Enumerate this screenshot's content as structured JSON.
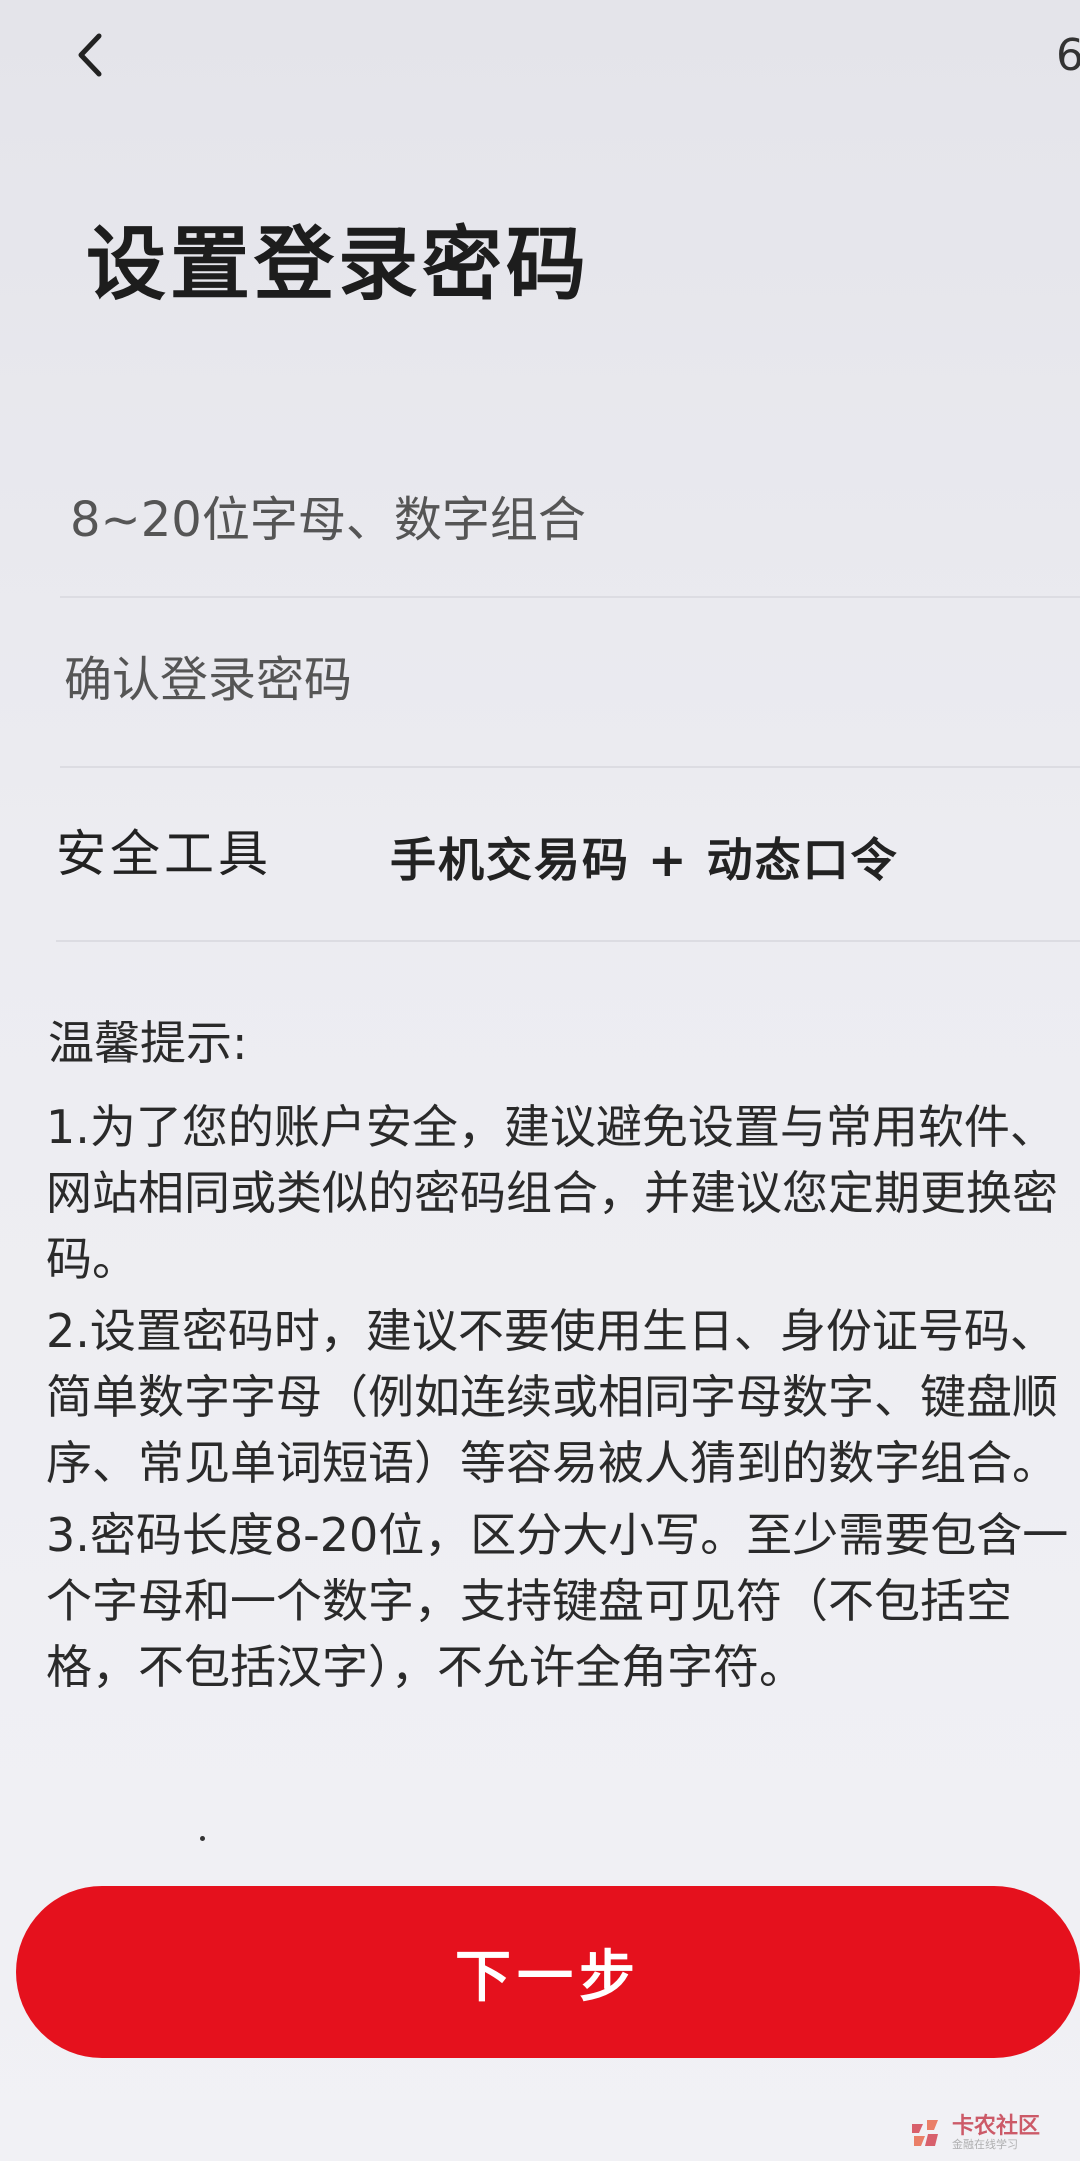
{
  "header": {
    "back_icon": "chevron-left-icon",
    "corner_glyph": "6",
    "title": "设置登录密码"
  },
  "form": {
    "password_placeholder": "8~20位字母、数字组合",
    "confirm_placeholder": "确认登录密码",
    "security_label": "安全工具",
    "security_value": "手机交易码 + 动态口令"
  },
  "tips": {
    "heading": "温馨提示:",
    "items": [
      "1.为了您的账户安全，建议避免设置与常用软件、网站相同或类似的密码组合，并建议您定期更换密码。",
      "2.设置密码时，建议不要使用生日、身份证号码、简单数字字母（例如连续或相同字母数字、键盘顺序、常见单词短语）等容易被人猜到的数字组合。",
      "3.密码长度8-20位，区分大小写。至少需要包含一个字母和一个数字，支持键盘可见符（不包括空格，不包括汉字），不允许全角字符。"
    ]
  },
  "actions": {
    "next_label": "下一步",
    "accent_color": "#e5111d"
  },
  "watermark": {
    "name": "卡农社区",
    "tagline": "金融在线学习"
  }
}
